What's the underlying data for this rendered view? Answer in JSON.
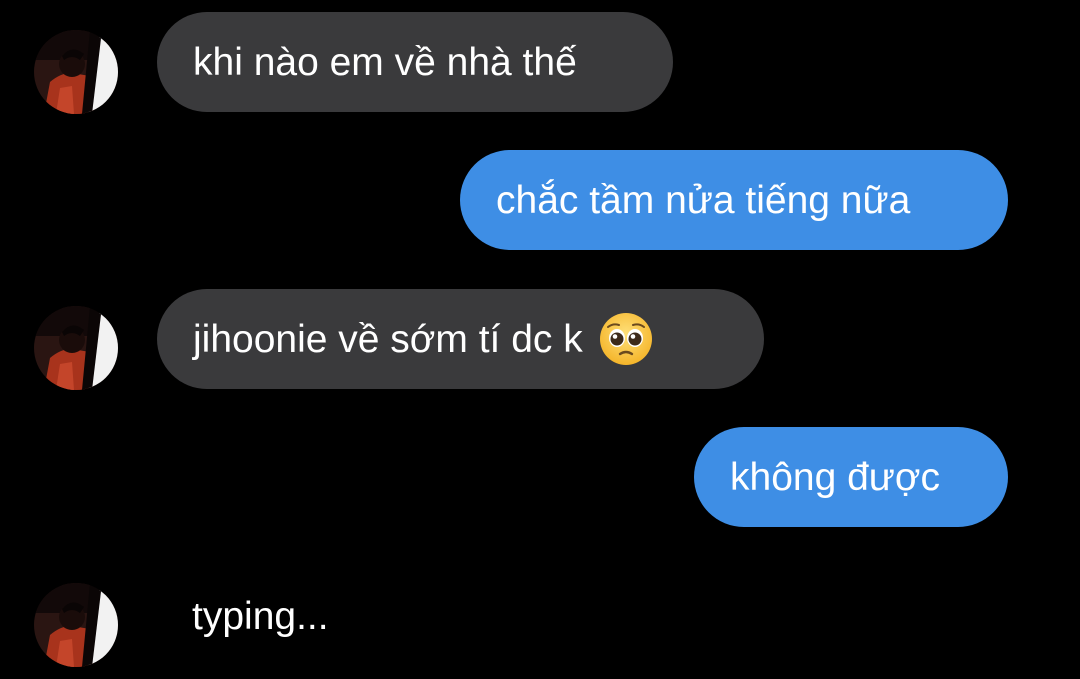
{
  "conversation": {
    "messages": [
      {
        "direction": "incoming",
        "text": "khi nào em về nhà thế"
      },
      {
        "direction": "outgoing",
        "text": "chắc tầm nửa tiếng nữa"
      },
      {
        "direction": "incoming",
        "text": "jihoonie về sớm tí dc k",
        "emoji": "pleading-face-emoji"
      },
      {
        "direction": "outgoing",
        "text": "không được"
      }
    ],
    "typing_indicator": "typing..."
  },
  "colors": {
    "background": "#000000",
    "incoming_bubble": "#3a3a3c",
    "outgoing_bubble": "#3e8ee5",
    "text": "#ffffff"
  },
  "icons": {
    "avatar": "contact-avatar",
    "emoji": "pleading-face-emoji"
  }
}
